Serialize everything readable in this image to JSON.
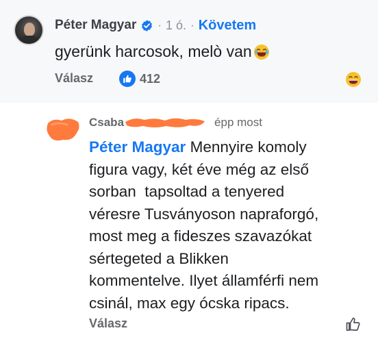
{
  "top_comment": {
    "author": "Péter Magyar",
    "dot1": "·",
    "time": "1 ó.",
    "dot2": "·",
    "follow_label": "Követem",
    "text": "gyerünk harcosok, melò van",
    "reply_label": "Válasz",
    "like_count": "412"
  },
  "reply": {
    "author": "Csaba",
    "time": "épp most",
    "mention": "Péter Magyar",
    "lines": [
      " Mennyire komoly",
      "figura vagy, két éve még az első",
      "sorban  tapsoltad a tenyered",
      "véresre Tusványoson napraforgó,",
      "most meg a fideszes szavazókat",
      "sértegeted a Blikken",
      "kommentelve. Ilyet államférfi nem",
      "csinál, max egy ócska ripacs."
    ],
    "reply_label": "Válasz"
  },
  "colors": {
    "link_blue": "#1877f2",
    "muted_gray": "#65676b",
    "top_bg": "#f7f8fa",
    "redaction_orange": "#ff7a3d"
  },
  "icons": {
    "verified": "verified-badge-icon",
    "laugh": "laughing-emoji-icon",
    "like": "thumbs-up-icon"
  }
}
